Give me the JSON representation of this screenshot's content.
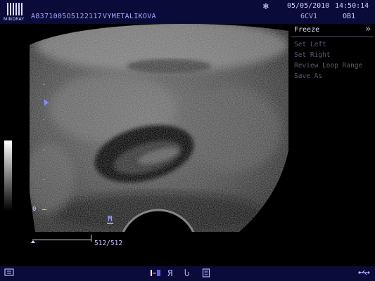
{
  "header": {
    "brand": "MINDRAY",
    "patient_id": "A8371005O5122117",
    "patient_name": "VYMETALIKOVA",
    "date": "05/05/2010",
    "time": "14:50:14",
    "probe": "6CV1",
    "exam": "OB1",
    "freeze_icon": "snowflake-icon"
  },
  "menu": {
    "title": "Freeze",
    "chevron_icon": "double-chevron-right-icon",
    "items": [
      {
        "label": "Set Left"
      },
      {
        "label": "Set Right"
      },
      {
        "label": "Review Loop Range"
      },
      {
        "label": "Save As"
      }
    ]
  },
  "image": {
    "depth_zero_label": "0",
    "orientation_mark": "M",
    "cine_counter": "512/512",
    "cine_position_fraction": 1.0
  },
  "bottom_bar": {
    "icons": [
      "screen-icon",
      "measure-icon",
      "report-icon",
      "return-icon",
      "document-icon",
      "usb-icon"
    ]
  },
  "colors": {
    "header_bg": "#0b0b3a",
    "text": "#c8c8ff",
    "menu_disabled": "#5a5a76"
  }
}
